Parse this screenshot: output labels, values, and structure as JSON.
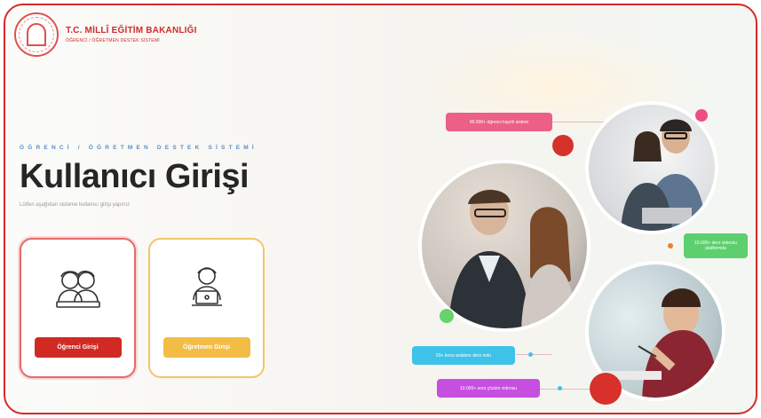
{
  "header": {
    "ministry": "T.C. MİLLÎ EĞİTİM BAKANLIĞI",
    "system_short": "ÖĞRENCİ / ÖĞRETMEN DESTEK SİSTEMİ"
  },
  "hero": {
    "subtitle": "ÖĞRENCİ / ÖĞRETMEN DESTEK SİSTEMİ",
    "title": "Kullanıcı Girişi",
    "description": "Lütfen aşağıdan sisteme kullanıcı girişi yapınız"
  },
  "cards": {
    "student_button": "Öğrenci Girişi",
    "teacher_button": "Öğretmen Girişi"
  },
  "pills": [
    {
      "text": "90.000+ öğrenci kayıtlı sistem",
      "color": "#ec5f86"
    },
    {
      "text": "10.000+ ders videosu platformda",
      "color": "#5dcf6f"
    },
    {
      "text": "50+ konu anlatımı ders notu",
      "color": "#3fc2e8"
    },
    {
      "text": "10.000+ soru çözüm videosu",
      "color": "#c64fe0"
    }
  ],
  "colors": {
    "accent": "#d42a2a",
    "yellow": "#f3bd45",
    "blue": "#5a8fc7"
  }
}
